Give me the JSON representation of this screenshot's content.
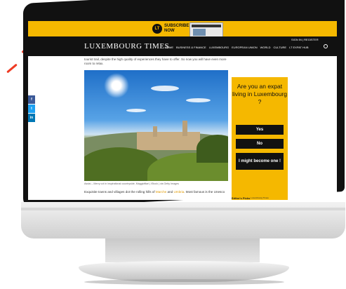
{
  "site": {
    "logo": "LUXEMBOURG TIMES",
    "subscribe": "SUBSCRIBE NOW",
    "subscribe_badge": "LT",
    "login": "SIGN IN | REGISTER",
    "nav": [
      "HOME",
      "BUSINESS & FINANCE",
      "LUXEMBOURG",
      "EUROPEAN UNION",
      "WORLD",
      "CULTURE",
      "LT EXPAT HUB"
    ]
  },
  "article": {
    "intro": "tourist trail, despite the high quality of experiences they have to offer. So now you will have even more room to relax.",
    "caption": "Assisi – Merry cot in inspirational countryside, Maggioftiari | iStock | via Getty Images",
    "body_start": "Exquisite towns and villages dot the rolling hills of ",
    "link1": "Marche",
    "body_mid": " and ",
    "link2": "Umbria",
    "body_end": ". Most famous is the Unesco"
  },
  "share": {
    "icons": [
      "facebook-icon",
      "twitter-icon",
      "linkedin-icon"
    ],
    "labels": [
      "f",
      "t",
      "in"
    ],
    "colors": [
      "#3b5998",
      "#1da1f2",
      "#0077b5"
    ]
  },
  "sidebar": {
    "question": "Are you an expat living in Luxembourg ?",
    "yes": "Yes",
    "no": "No",
    "maybe": "I might become one !",
    "powered": "Luxembourg Times",
    "editor": "Editor's Picks"
  },
  "colors": {
    "accent": "#f5b800",
    "header": "#111111",
    "dashes": "#ef3b24"
  }
}
